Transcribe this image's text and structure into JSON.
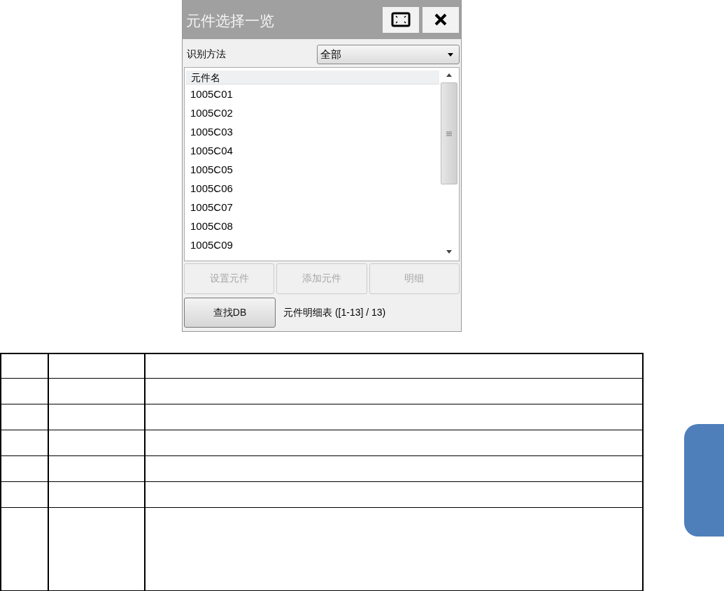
{
  "dialog": {
    "title": "元件选择一览",
    "filter": {
      "label": "识别方法",
      "value": "全部"
    },
    "list": {
      "header": "元件名",
      "items": [
        "1005C01",
        "1005C02",
        "1005C03",
        "1005C04",
        "1005C05",
        "1005C06",
        "1005C07",
        "1005C08",
        "1005C09"
      ]
    },
    "actions": [
      {
        "label": "设置元件",
        "disabled": true
      },
      {
        "label": "添加元件",
        "disabled": true
      },
      {
        "label": "明细",
        "disabled": true
      }
    ],
    "search_button": {
      "label": "查找DB",
      "disabled": false
    },
    "status": "元件明细表 ([1-13] / 13)"
  }
}
